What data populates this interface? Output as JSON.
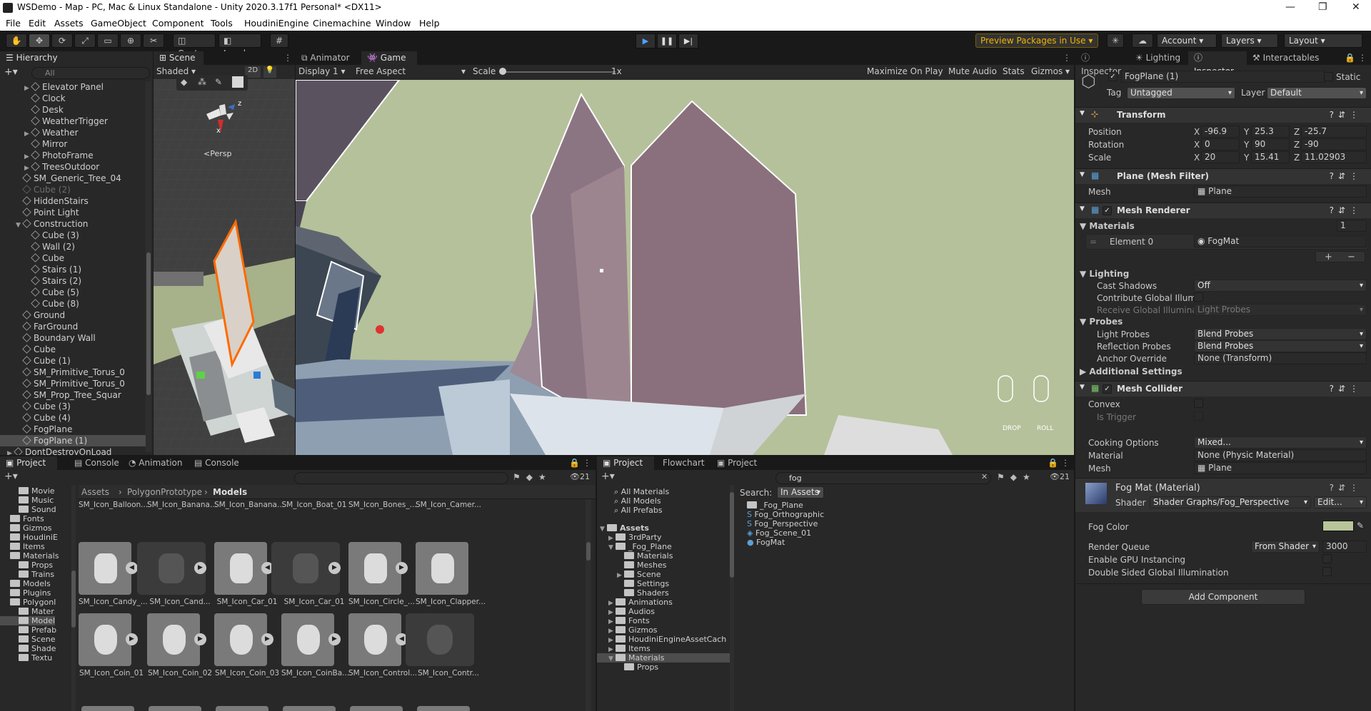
{
  "window": {
    "title": "WSDemo - Map - PC, Mac & Linux Standalone - Unity 2020.3.17f1 Personal* <DX11>"
  },
  "menu": [
    "File",
    "Edit",
    "Assets",
    "GameObject",
    "Component",
    "Tools",
    "HoudiniEngine",
    "Cinemachine",
    "Window",
    "Help"
  ],
  "toolbar": {
    "center": "Center",
    "local": "Local",
    "preview": "Preview Packages in Use",
    "account": "Account",
    "layers": "Layers",
    "layout": "Layout"
  },
  "hierarchy": {
    "tab": "Hierarchy",
    "search_placeholder": "All",
    "items": [
      {
        "label": "Elevator Panel",
        "indent": 2,
        "arrow": "▶",
        "dim": false
      },
      {
        "label": "Clock",
        "indent": 2,
        "arrow": "",
        "dim": false
      },
      {
        "label": "Desk",
        "indent": 2,
        "arrow": "",
        "dim": false
      },
      {
        "label": "WeatherTrigger",
        "indent": 2,
        "arrow": "",
        "dim": false
      },
      {
        "label": "Weather",
        "indent": 2,
        "arrow": "▶",
        "dim": false
      },
      {
        "label": "Mirror",
        "indent": 2,
        "arrow": "",
        "dim": false
      },
      {
        "label": "PhotoFrame",
        "indent": 2,
        "arrow": "▶",
        "dim": false
      },
      {
        "label": "TreesOutdoor",
        "indent": 2,
        "arrow": "▶",
        "dim": false
      },
      {
        "label": "SM_Generic_Tree_04",
        "indent": 1,
        "arrow": "",
        "dim": false
      },
      {
        "label": "Cube (2)",
        "indent": 1,
        "arrow": "",
        "dim": true
      },
      {
        "label": "HiddenStairs",
        "indent": 1,
        "arrow": "",
        "dim": false
      },
      {
        "label": "Point Light",
        "indent": 1,
        "arrow": "",
        "dim": false
      },
      {
        "label": "Construction",
        "indent": 1,
        "arrow": "▼",
        "dim": false
      },
      {
        "label": "Cube (3)",
        "indent": 2,
        "arrow": "",
        "dim": false
      },
      {
        "label": "Wall (2)",
        "indent": 2,
        "arrow": "",
        "dim": false
      },
      {
        "label": "Cube",
        "indent": 2,
        "arrow": "",
        "dim": false
      },
      {
        "label": "Stairs (1)",
        "indent": 2,
        "arrow": "",
        "dim": false
      },
      {
        "label": "Stairs (2)",
        "indent": 2,
        "arrow": "",
        "dim": false
      },
      {
        "label": "Cube (5)",
        "indent": 2,
        "arrow": "",
        "dim": false
      },
      {
        "label": "Cube (8)",
        "indent": 2,
        "arrow": "",
        "dim": false
      },
      {
        "label": "Ground",
        "indent": 1,
        "arrow": "",
        "dim": false
      },
      {
        "label": "FarGround",
        "indent": 1,
        "arrow": "",
        "dim": false
      },
      {
        "label": "Boundary Wall",
        "indent": 1,
        "arrow": "",
        "dim": false
      },
      {
        "label": "Cube",
        "indent": 1,
        "arrow": "",
        "dim": false
      },
      {
        "label": "Cube (1)",
        "indent": 1,
        "arrow": "",
        "dim": false
      },
      {
        "label": "SM_Primitive_Torus_0",
        "indent": 1,
        "arrow": "",
        "dim": false
      },
      {
        "label": "SM_Primitive_Torus_0",
        "indent": 1,
        "arrow": "",
        "dim": false
      },
      {
        "label": "SM_Prop_Tree_Squar",
        "indent": 1,
        "arrow": "",
        "dim": false
      },
      {
        "label": "Cube (3)",
        "indent": 1,
        "arrow": "",
        "dim": false
      },
      {
        "label": "Cube (4)",
        "indent": 1,
        "arrow": "",
        "dim": false
      },
      {
        "label": "FogPlane",
        "indent": 1,
        "arrow": "",
        "dim": false
      },
      {
        "label": "FogPlane (1)",
        "indent": 1,
        "arrow": "",
        "dim": false
      },
      {
        "label": "DontDestroyOnLoad",
        "indent": 0,
        "arrow": "▶",
        "dim": false
      }
    ]
  },
  "scene": {
    "tab": "Scene",
    "shading": "Shaded",
    "mode2d": "2D",
    "persp": "<Persp",
    "axis_y": "y",
    "axis_z": "z",
    "axis_x": "x"
  },
  "game": {
    "tab_animator": "Animator",
    "tab_game": "Game",
    "display": "Display 1",
    "aspect": "Free Aspect",
    "scale_label": "Scale",
    "scale_value": "1x",
    "maximize": "Maximize On Play",
    "mute": "Mute Audio",
    "stats": "Stats",
    "gizmos": "Gizmos",
    "drop": "DROP",
    "roll": "ROLL"
  },
  "inspector": {
    "tabs": [
      "Inspector",
      "Lighting",
      "Inspector",
      "Interactables"
    ],
    "object_name": "FogPlane (1)",
    "static": "Static",
    "tag_label": "Tag",
    "tag": "Untagged",
    "layer_label": "Layer",
    "layer": "Default",
    "transform": {
      "title": "Transform",
      "position": {
        "label": "Position",
        "x": "-96.9",
        "y": "25.3",
        "z": "-25.7"
      },
      "rotation": {
        "label": "Rotation",
        "x": "0",
        "y": "90",
        "z": "-90"
      },
      "scale": {
        "label": "Scale",
        "x": "20",
        "y": "15.41",
        "z": "11.02903"
      }
    },
    "axis": {
      "x": "X",
      "y": "Y",
      "z": "Z"
    },
    "mesh_filter": {
      "title": "Plane (Mesh Filter)",
      "mesh_label": "Mesh",
      "mesh": "Plane"
    },
    "mesh_renderer": {
      "title": "Mesh Renderer",
      "materials_label": "Materials",
      "materials_count": "1",
      "element_label": "Element 0",
      "element": "FogMat",
      "plus": "+",
      "minus": "−",
      "lighting": "Lighting",
      "cast_shadows_label": "Cast Shadows",
      "cast_shadows": "Off",
      "contribute_gi": "Contribute Global Illumi",
      "receive_gi": "Receive Global Illumina",
      "receive_gi_value": "Light Probes",
      "probes": "Probes",
      "light_probes_label": "Light Probes",
      "light_probes": "Blend Probes",
      "reflection_probes_label": "Reflection Probes",
      "reflection_probes": "Blend Probes",
      "anchor_label": "Anchor Override",
      "anchor": "None (Transform)",
      "additional": "Additional Settings"
    },
    "mesh_collider": {
      "title": "Mesh Collider",
      "convex": "Convex",
      "is_trigger": "Is Trigger",
      "cooking_label": "Cooking Options",
      "cooking": "Mixed...",
      "material_label": "Material",
      "material": "None (Physic Material)",
      "mesh_label": "Mesh",
      "mesh": "Plane"
    },
    "material": {
      "title": "Fog Mat (Material)",
      "shader_label": "Shader",
      "shader": "Shader Graphs/Fog_Perspective",
      "edit": "Edit...",
      "fog_color_label": "Fog Color",
      "fog_color": "#b8c49a",
      "render_queue_label": "Render Queue",
      "render_queue_mode": "From Shader",
      "render_queue": "3000",
      "gpu_instancing": "Enable GPU Instancing",
      "double_sided": "Double Sided Global Illumination"
    },
    "add_component": "Add Component"
  },
  "project_left": {
    "tabs": [
      "Project",
      "Console",
      "Animation",
      "Console"
    ],
    "count": "21",
    "tree": [
      {
        "label": "Movie",
        "indent": 2
      },
      {
        "label": "Music",
        "indent": 2
      },
      {
        "label": "Sound",
        "indent": 2
      },
      {
        "label": "Fonts",
        "indent": 1
      },
      {
        "label": "Gizmos",
        "indent": 1
      },
      {
        "label": "HoudiniE",
        "indent": 1
      },
      {
        "label": "Items",
        "indent": 1
      },
      {
        "label": "Materials",
        "indent": 1
      },
      {
        "label": "Props",
        "indent": 2
      },
      {
        "label": "Trains",
        "indent": 2
      },
      {
        "label": "Models",
        "indent": 1
      },
      {
        "label": "Plugins",
        "indent": 1
      },
      {
        "label": "Polygonl",
        "indent": 1
      },
      {
        "label": "Mater",
        "indent": 2
      },
      {
        "label": "Model",
        "indent": 2
      },
      {
        "label": "Prefab",
        "indent": 2
      },
      {
        "label": "Scene",
        "indent": 2
      },
      {
        "label": "Shade",
        "indent": 2
      },
      {
        "label": "Textu",
        "indent": 2
      }
    ],
    "breadcrumb": [
      "Assets",
      "PolygonPrototype",
      "Models"
    ],
    "row0": [
      "SM_Icon_Balloon...",
      "SM_Icon_Banana...",
      "SM_Icon_Banana...",
      "SM_Icon_Boat_01",
      "SM_Icon_Bones_...",
      "SM_Icon_Camer..."
    ],
    "row1": [
      "SM_Icon_Candy_...",
      "SM_Icon_Cand...",
      "SM_Icon_Car_01",
      "SM_Icon_Car_01",
      "SM_Icon_Circle_...",
      "SM_Icon_Clapper..."
    ],
    "row2": [
      "SM_Icon_Coin_01",
      "SM_Icon_Coin_02",
      "SM_Icon_Coin_03",
      "SM_Icon_CoinBa...",
      "SM_Icon_Control...",
      "SM_Icon_Contr..."
    ]
  },
  "project_right": {
    "tabs": [
      "Project",
      "Flowchart",
      "Project"
    ],
    "search": "fog",
    "count": "21",
    "favorites": [
      "All Materials",
      "All Models",
      "All Prefabs"
    ],
    "tree": [
      {
        "label": "Assets",
        "indent": 0,
        "bold": true
      },
      {
        "label": "3rdParty",
        "indent": 1
      },
      {
        "label": "_Fog_Plane",
        "indent": 1
      },
      {
        "label": "Materials",
        "indent": 2
      },
      {
        "label": "Meshes",
        "indent": 2
      },
      {
        "label": "Scene",
        "indent": 2
      },
      {
        "label": "Settings",
        "indent": 2
      },
      {
        "label": "Shaders",
        "indent": 2
      },
      {
        "label": "Animations",
        "indent": 1
      },
      {
        "label": "Audios",
        "indent": 1
      },
      {
        "label": "Fonts",
        "indent": 1
      },
      {
        "label": "Gizmos",
        "indent": 1
      },
      {
        "label": "HoudiniEngineAssetCach",
        "indent": 1
      },
      {
        "label": "Items",
        "indent": 1
      },
      {
        "label": "Materials",
        "indent": 1
      },
      {
        "label": "Props",
        "indent": 2
      }
    ],
    "search_label": "Search:",
    "search_scope": "In Assets",
    "results": [
      "_Fog_Plane",
      "Fog_Orthographic",
      "Fog_Perspective",
      "Fog_Scene_01",
      "FogMat"
    ]
  },
  "colors": {
    "accent": "#3a79bb",
    "fog": "#b8c49a",
    "selection": "#2c5d87",
    "building": "#8a6f7c"
  }
}
